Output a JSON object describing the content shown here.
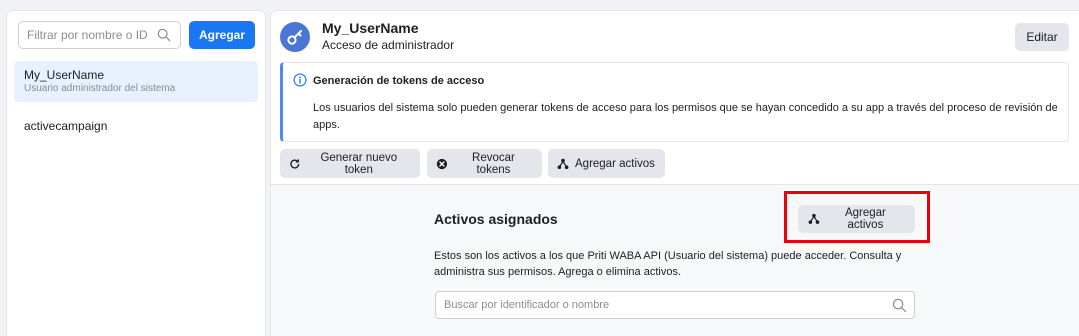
{
  "sidebar": {
    "filter_placeholder": "Filtrar por nombre o ID",
    "add_label": "Agregar",
    "users": [
      {
        "name": "My_UserName",
        "subtitle": "Usuario administrador del sistema",
        "selected": true
      },
      {
        "name": "activecampaign",
        "subtitle": "",
        "selected": false
      }
    ]
  },
  "header": {
    "title": "My_UserName",
    "subtitle": "Acceso de administrador",
    "edit_label": "Editar",
    "icon": "key-icon"
  },
  "notice": {
    "icon": "info-icon",
    "title": "Generación de tokens de acceso",
    "body": "Los usuarios del sistema solo pueden generar tokens de acceso para los permisos que se hayan concedido a su app a través del proceso de revisión de apps."
  },
  "actions": {
    "generate_label": "Generar nuevo token",
    "revoke_label": "Revocar tokens",
    "add_assets_label": "Agregar activos"
  },
  "assets": {
    "title": "Activos asignados",
    "add_label": "Agregar activos",
    "description": "Estos son los activos a los que Priti WABA API (Usuario del sistema) puede acceder. Consulta y administra sus permisos. Agrega o elimina activos.",
    "search_placeholder": "Buscar por identificador o nombre"
  },
  "colors": {
    "accent": "#1877f2",
    "highlight": "#e8000d",
    "notice_border": "#4b8bf4"
  }
}
